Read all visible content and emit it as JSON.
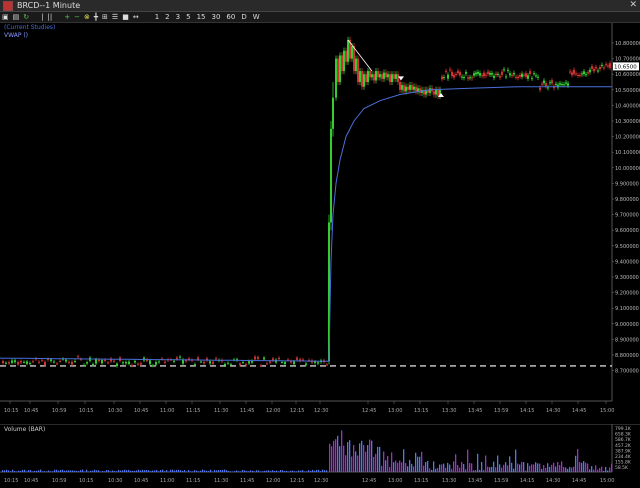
{
  "window": {
    "title": "BRCD--1 Minute",
    "close_glyph": "✕"
  },
  "toolbar": {
    "buttons": [
      {
        "icon": "lock-icon",
        "glyph": "▣"
      },
      {
        "icon": "print-icon",
        "glyph": "▤"
      },
      {
        "icon": "refresh-icon",
        "glyph": "↻"
      },
      {
        "icon": "scroll-icon",
        "glyph": "|"
      },
      {
        "icon": "pause-icon",
        "glyph": "||"
      },
      {
        "icon": "zoom-in-icon",
        "glyph": "+"
      },
      {
        "icon": "zoom-out-icon",
        "glyph": "−"
      },
      {
        "icon": "draw-icon",
        "glyph": "⊗"
      },
      {
        "icon": "crosshair-icon",
        "glyph": "╋"
      },
      {
        "icon": "grid-icon",
        "glyph": "⊞"
      },
      {
        "icon": "list-icon",
        "glyph": "☰"
      },
      {
        "icon": "camera-icon",
        "glyph": "■"
      },
      {
        "icon": "arrows-icon",
        "glyph": "↔"
      }
    ],
    "intervals": [
      "1",
      "2",
      "3",
      "5",
      "15",
      "30",
      "60",
      "D",
      "W"
    ]
  },
  "price_pane": {
    "indicator_labels": [
      "(Current Studies)",
      "VWAP ()"
    ],
    "price_axis": [
      "10.800000",
      "10.700000",
      "10.600000",
      "10.500000",
      "10.400000",
      "10.300000",
      "10.200000",
      "10.100000",
      "10.000000",
      "9.900000",
      "9.800000",
      "9.700000",
      "9.600000",
      "9.500000",
      "9.400000",
      "9.300000",
      "9.200000",
      "9.100000",
      "9.000000",
      "8.900000",
      "8.800000",
      "8.700000"
    ],
    "current_price": "10.6500",
    "time_axis": [
      "10:15",
      "10:45",
      "10:59",
      "10:15",
      "10:30",
      "10:45",
      "11:00",
      "11:15",
      "11:30",
      "11:45",
      "12:00",
      "12:15",
      "12:30",
      "12:45",
      "13:00",
      "13:15",
      "13:30",
      "13:45",
      "13:59",
      "14:15",
      "14:30",
      "14:45",
      "15:00",
      "15:15"
    ]
  },
  "volume_pane": {
    "label": "Volume (BAR)",
    "axis": [
      "799.1K",
      "658.3K",
      "586.7K",
      "457.2K",
      "387.9K",
      "234.4K",
      "155.8K",
      "58.5K"
    ]
  },
  "colors": {
    "up": "#33cc33",
    "down": "#cc3333",
    "vwap": "#4a6fd9",
    "volume_blue": "#5577ee",
    "volume_purple": "#9933cc",
    "dashed_line": "#ffffff",
    "trend_line": "#ffffff",
    "label_blue": "#4a6fd9"
  }
}
